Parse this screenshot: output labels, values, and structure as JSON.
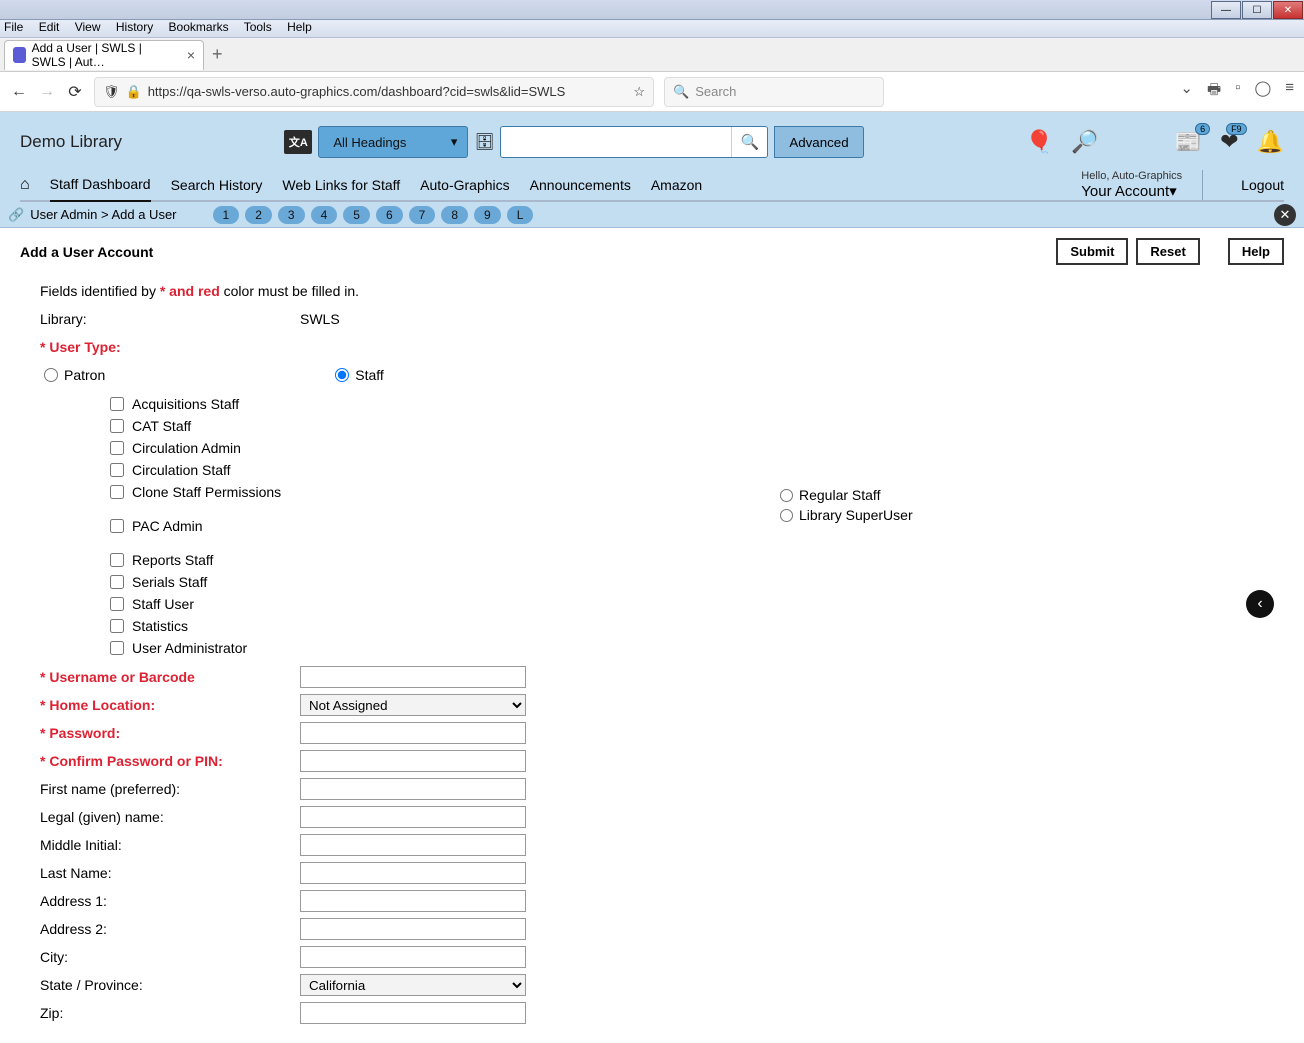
{
  "browser": {
    "menus": [
      "File",
      "Edit",
      "View",
      "History",
      "Bookmarks",
      "Tools",
      "Help"
    ],
    "tab_title": "Add a User | SWLS | SWLS | Aut…",
    "url": "https://qa-swls-verso.auto-graphics.com/dashboard?cid=swls&lid=SWLS",
    "search_placeholder": "Search"
  },
  "header": {
    "library_name": "Demo Library",
    "headings_dropdown": "All Headings",
    "advanced": "Advanced",
    "badge_count": "6",
    "fav_badge": "F9",
    "hello": "Hello, Auto-Graphics",
    "account": "Your Account",
    "logout": "Logout",
    "nav": [
      "Staff Dashboard",
      "Search History",
      "Web Links for Staff",
      "Auto-Graphics",
      "Announcements",
      "Amazon"
    ]
  },
  "crumb": {
    "path": "User Admin > Add a User",
    "pills": [
      "1",
      "2",
      "3",
      "4",
      "5",
      "6",
      "7",
      "8",
      "9",
      "L"
    ]
  },
  "page": {
    "title": "Add a User Account",
    "submit": "Submit",
    "reset": "Reset",
    "help": "Help"
  },
  "form": {
    "hint_prefix": "Fields identified by ",
    "hint_mid": "* and red",
    "hint_suffix": " color must be filled in.",
    "library_label": "Library:",
    "library_value": "SWLS",
    "usertype_label": "* User Type:",
    "patron": "Patron",
    "staff": "Staff",
    "checks": [
      "Acquisitions Staff",
      "CAT Staff",
      "Circulation Admin",
      "Circulation Staff",
      "Clone Staff Permissions",
      "",
      "PAC Admin",
      "",
      "Reports Staff",
      "Serials Staff",
      "Staff User",
      "Statistics",
      "User Administrator"
    ],
    "staff_types": [
      "Regular Staff",
      "Library SuperUser"
    ],
    "fields": [
      {
        "label": "* Username or Barcode",
        "required": true,
        "type": "text"
      },
      {
        "label": "* Home Location:",
        "required": true,
        "type": "select",
        "value": "Not Assigned"
      },
      {
        "label": "* Password:",
        "required": true,
        "type": "text"
      },
      {
        "label": "* Confirm Password or PIN:",
        "required": true,
        "type": "text"
      },
      {
        "label": "First name (preferred):",
        "required": false,
        "type": "text"
      },
      {
        "label": "Legal (given) name:",
        "required": false,
        "type": "text"
      },
      {
        "label": "Middle Initial:",
        "required": false,
        "type": "text"
      },
      {
        "label": "Last Name:",
        "required": false,
        "type": "text"
      },
      {
        "label": "Address 1:",
        "required": false,
        "type": "text"
      },
      {
        "label": "Address 2:",
        "required": false,
        "type": "text"
      },
      {
        "label": "City:",
        "required": false,
        "type": "text"
      },
      {
        "label": "State / Province:",
        "required": false,
        "type": "select",
        "value": "California"
      },
      {
        "label": "Zip:",
        "required": false,
        "type": "text"
      }
    ]
  }
}
